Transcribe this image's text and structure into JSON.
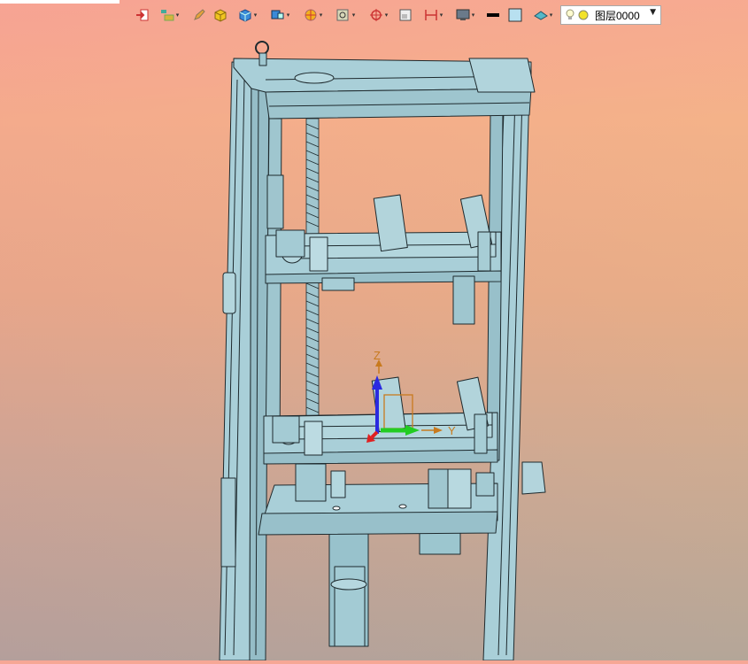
{
  "toolbar": {
    "buttons": [
      {
        "icon": "exit-icon"
      },
      {
        "icon": "feature-tree-icon",
        "dropdown": true
      },
      {
        "icon": "pencil-sketch-icon"
      },
      {
        "icon": "yellow-cube-icon"
      },
      {
        "icon": "blue-box-icon",
        "dropdown": true
      },
      {
        "icon": "view-orientation-icon",
        "dropdown": true
      },
      {
        "icon": "section-view-icon",
        "dropdown": true
      },
      {
        "icon": "zoom-fit-icon",
        "dropdown": true
      },
      {
        "icon": "target-origin-icon",
        "dropdown": true
      },
      {
        "icon": "single-window-icon"
      },
      {
        "icon": "dimension-icon",
        "dropdown": true
      },
      {
        "icon": "monitor-display-icon",
        "dropdown": true
      },
      {
        "icon": "line-color-icon"
      },
      {
        "icon": "fill-color-icon"
      },
      {
        "icon": "render-style-icon",
        "dropdown": true
      }
    ],
    "layer_select": {
      "value": "图层0000",
      "icons": [
        "lightbulb-icon",
        "yellow-circle-icon"
      ]
    }
  },
  "triad": {
    "z_label": "Z",
    "y_label": "Y"
  },
  "colors": {
    "model_fill": "#a9cfd8",
    "model_stroke": "#1e2a2e",
    "x_axis": "#e02020",
    "y_axis": "#22cc22",
    "z_axis": "#2a2ae0",
    "triad_label": "#c87a1e"
  }
}
